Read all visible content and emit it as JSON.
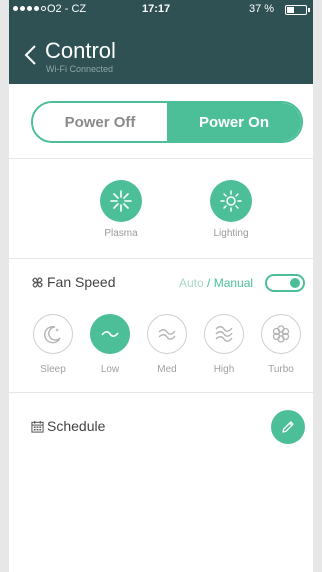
{
  "status_bar": {
    "carrier": "O2 - CZ",
    "time": "17:17",
    "battery": "37 %"
  },
  "nav": {
    "title": "Control",
    "subtitle": "Wi-Fi Connected",
    "back_icon": "chevron-left-icon"
  },
  "power": {
    "off_label": "Power Off",
    "on_label": "Power On",
    "selected": "on"
  },
  "features": [
    {
      "label": "Plasma",
      "icon": "plasma-icon"
    },
    {
      "label": "Lighting",
      "icon": "sun-icon"
    }
  ],
  "fan_speed": {
    "title": "Fan Speed",
    "icon": "fan-icon",
    "mode_auto": "Auto",
    "mode_separator": " / ",
    "mode_manual": "Manual",
    "manual_enabled": true,
    "speeds": [
      {
        "label": "Sleep",
        "icon": "moon-icon"
      },
      {
        "label": "Low",
        "icon": "wave-icon",
        "active": true
      },
      {
        "label": "Med",
        "icon": "waves-2-icon"
      },
      {
        "label": "High",
        "icon": "waves-3-icon"
      },
      {
        "label": "Turbo",
        "icon": "flower-icon"
      }
    ]
  },
  "schedule": {
    "title": "Schedule",
    "icon": "calendar-icon",
    "edit_icon": "pencil-icon"
  },
  "colors": {
    "accent": "#4cbf98",
    "header": "#2f5154"
  }
}
